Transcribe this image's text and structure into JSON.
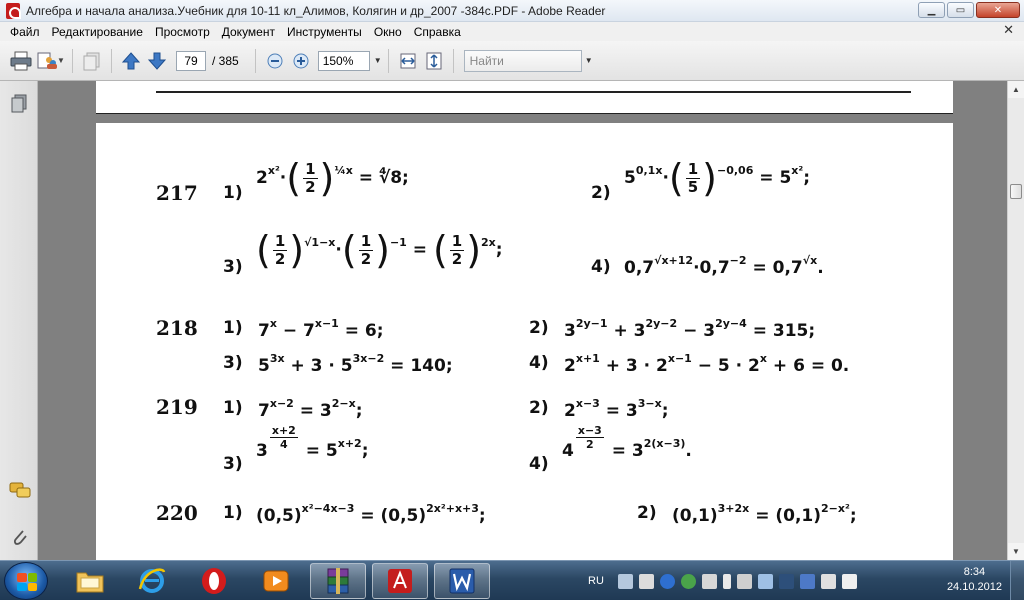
{
  "window": {
    "title": "Алгебра и начала анализа.Учебник для 10-11 кл_Алимов, Колягин и др_2007 -384с.PDF - Adobe Reader",
    "minimize": "▁",
    "maximize": "▭",
    "close": "✕"
  },
  "menu": {
    "items": [
      "Файл",
      "Редактирование",
      "Просмотр",
      "Документ",
      "Инструменты",
      "Окно",
      "Справка"
    ],
    "close_doc": "✕"
  },
  "toolbar": {
    "page_current": "79",
    "page_total": "/ 385",
    "zoom": "150%",
    "search_placeholder": "Найти"
  },
  "document": {
    "p217": "217",
    "p218": "218",
    "p219": "219",
    "p220": "220",
    "i1": "1)",
    "i2": "2)",
    "i3": "3)",
    "i4": "4)"
  },
  "taskbar": {
    "lang": "RU",
    "time": "8:34",
    "date": "24.10.2012"
  },
  "colors": {
    "acrobat_red": "#c41d1d",
    "taskbar_blue": "#2b4763",
    "doc_background": "#808080"
  }
}
